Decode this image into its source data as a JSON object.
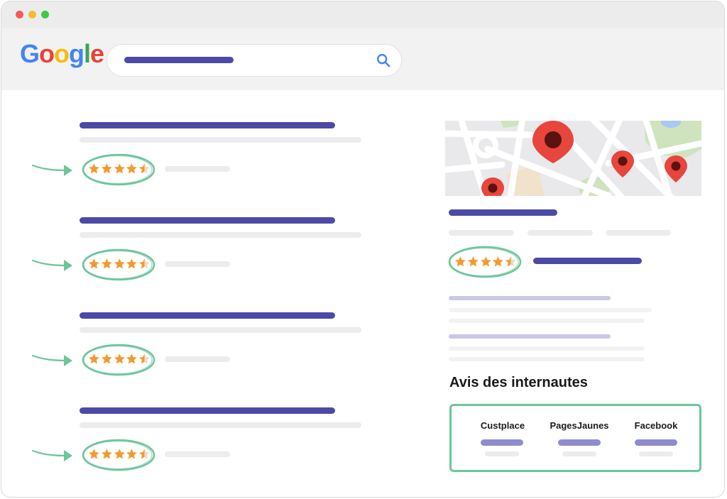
{
  "window": {
    "controls": [
      "close",
      "minimize",
      "maximize"
    ]
  },
  "header": {
    "logo": {
      "letters": [
        {
          "ch": "G",
          "color": "#4285f4"
        },
        {
          "ch": "o",
          "color": "#ea4335"
        },
        {
          "ch": "o",
          "color": "#fbbc05"
        },
        {
          "ch": "g",
          "color": "#4285f4"
        },
        {
          "ch": "l",
          "color": "#34a853"
        },
        {
          "ch": "e",
          "color": "#ea4335"
        }
      ]
    },
    "search_icon": "search-icon"
  },
  "results": {
    "count": 4,
    "rating": 4.5
  },
  "knowledge_panel": {
    "rating": 4.5,
    "map_pins": 4,
    "reviews_heading": "Avis des internautes",
    "sources": [
      {
        "name": "Custplace"
      },
      {
        "name": "PagesJaunes"
      },
      {
        "name": "Facebook"
      }
    ]
  },
  "colors": {
    "accent": "#4c4aa6",
    "highlight": "#6cc69a",
    "star": "#f39a2e",
    "pin": "#e8453c"
  }
}
